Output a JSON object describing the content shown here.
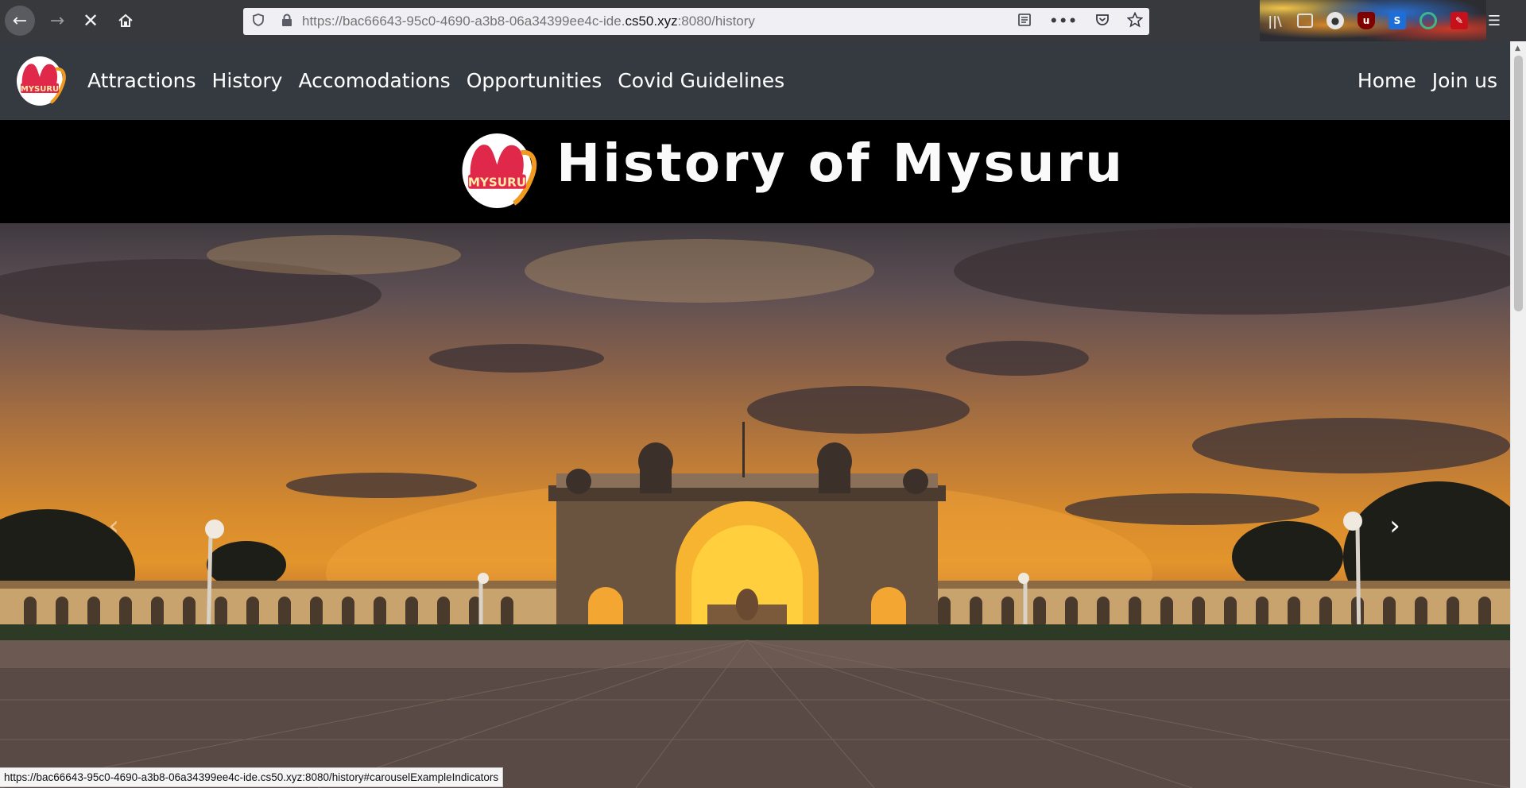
{
  "browser": {
    "url_prefix": "https://bac66643-95c0-4690-a3b8-06a34399ee4c-ide.",
    "url_domain": "cs50.xyz",
    "url_suffix": ":8080/history",
    "icons": [
      "back-icon",
      "forward-icon",
      "stop-icon",
      "home-icon",
      "shield-icon",
      "lock-icon",
      "reader-icon",
      "more-icon",
      "pocket-icon",
      "star-icon",
      "library-icon",
      "sidebar-icon",
      "account-icon",
      "ublock-icon",
      "s-extension-icon",
      "sync-extension-icon",
      "red-extension-icon",
      "menu-icon"
    ]
  },
  "nav": {
    "logo_text": "MYSURU",
    "links": [
      "Attractions",
      "History",
      "Accomodations",
      "Opportunities",
      "Covid Guidelines"
    ],
    "right_links": [
      "Home",
      "Join us"
    ]
  },
  "banner": {
    "logo_text": "MYSURU",
    "title": "History of Mysuru"
  },
  "carousel": {
    "prev_glyph": "‹",
    "next_glyph": "›"
  },
  "status": {
    "text": "https://bac66643-95c0-4690-a3b8-06a34399ee4c-ide.cs50.xyz:8080/history#carouselExampleIndicators"
  },
  "colors": {
    "navbar": "#343a40",
    "banner": "#000000",
    "logo_red": "#e0284a",
    "logo_orange": "#f29a1f"
  }
}
